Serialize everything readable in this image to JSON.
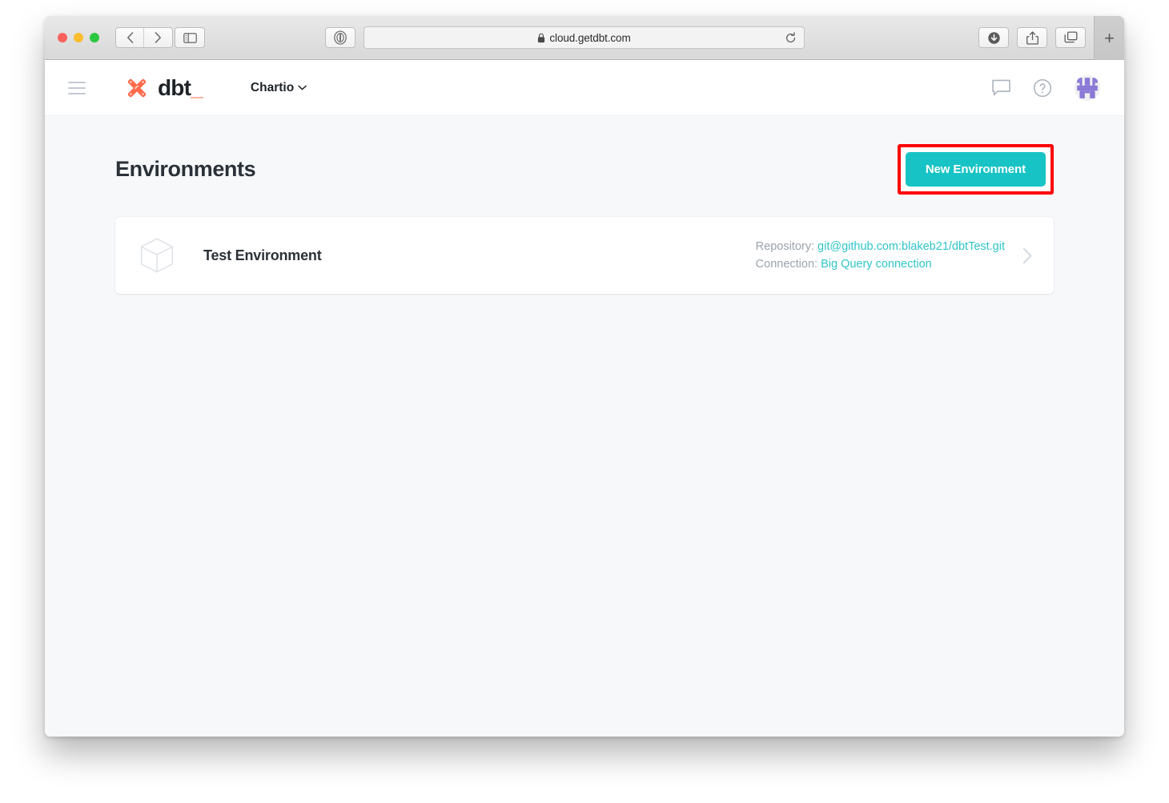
{
  "browser": {
    "window_controls": [
      "close",
      "minimize",
      "zoom"
    ],
    "back_icon": "chevron-left-icon",
    "forward_icon": "chevron-right-icon",
    "sidebar_icon": "sidebar-toggle-icon",
    "reader_icon": "reader-view-icon",
    "url": "cloud.getdbt.com",
    "lock_icon": "lock-icon",
    "reload_icon": "reload-icon",
    "downloads_icon": "downloads-icon",
    "share_icon": "share-icon",
    "tabs_icon": "show-tabs-icon",
    "new_tab_label": "+"
  },
  "app_header": {
    "menu_icon": "hamburger-menu-icon",
    "logo_icon": "dbt-logo-icon",
    "logo_text": "dbt",
    "logo_underscore": "_",
    "account_name": "Chartio",
    "account_chevron_icon": "chevron-down-icon",
    "feedback_icon": "chat-bubble-icon",
    "help_icon": "help-circle-icon",
    "avatar_icon": "user-avatar-identicon"
  },
  "page": {
    "title": "Environments",
    "new_environment_label": "New Environment",
    "highlight_color": "#ff0000",
    "accent_color": "#17c3c4"
  },
  "environments": [
    {
      "icon": "cube-icon",
      "name": "Test Environment",
      "repository_label": "Repository:",
      "repository_value": "git@github.com:blakeb21/dbtTest.git",
      "connection_label": "Connection:",
      "connection_value": "Big Query connection",
      "chevron_icon": "chevron-right-icon"
    }
  ]
}
